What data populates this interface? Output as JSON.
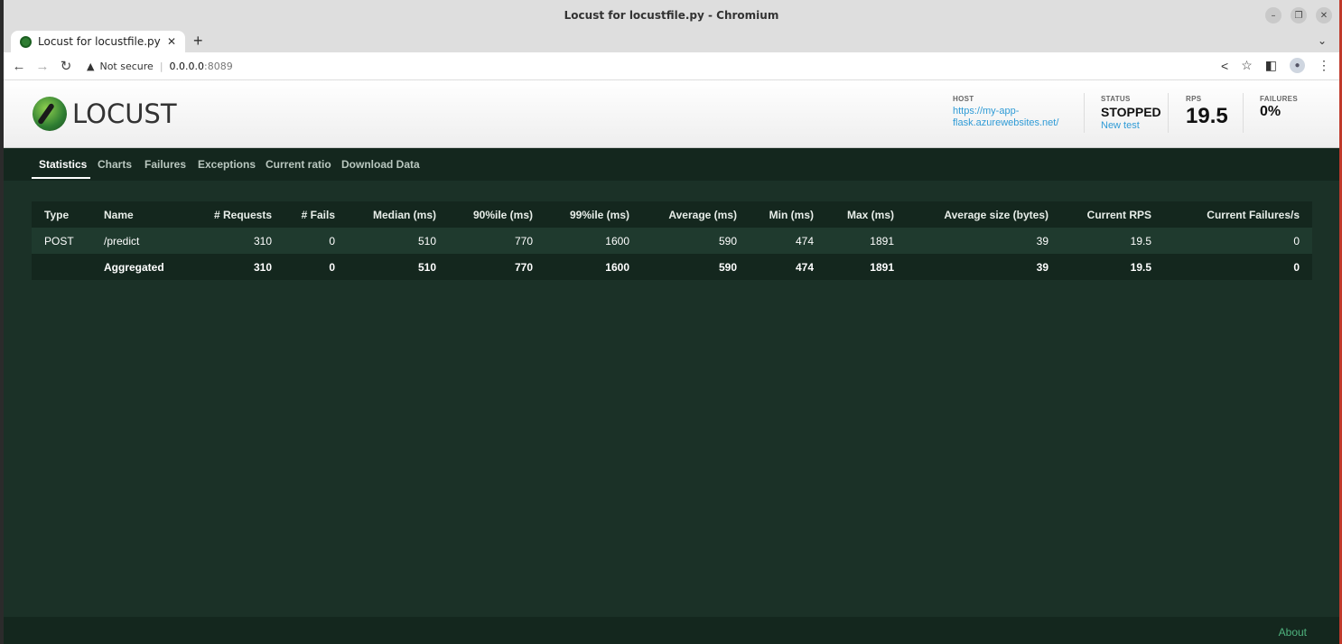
{
  "window": {
    "title": "Locust for locustfile.py - Chromium"
  },
  "browser": {
    "tab_title": "Locust for locustfile.py",
    "new_tab": "+",
    "security_label": "Not secure",
    "url_host": "0.0.0.0",
    "url_port": ":8089"
  },
  "header": {
    "logo_text": "LOCUST",
    "host_label": "HOST",
    "host_line1": "https://my-app-",
    "host_line2": "flask.azurewebsites.net/",
    "status_label": "STATUS",
    "status_value": "STOPPED",
    "new_test": "New test",
    "rps_label": "RPS",
    "rps_value": "19.5",
    "failures_label": "FAILURES",
    "failures_value": "0%"
  },
  "nav": {
    "tabs": [
      "Statistics",
      "Charts",
      "Failures",
      "Exceptions",
      "Current ratio",
      "Download Data"
    ]
  },
  "table": {
    "headers": [
      "Type",
      "Name",
      "# Requests",
      "# Fails",
      "Median (ms)",
      "90%ile (ms)",
      "99%ile (ms)",
      "Average (ms)",
      "Min (ms)",
      "Max (ms)",
      "Average size (bytes)",
      "Current RPS",
      "Current Failures/s"
    ],
    "rows": [
      [
        "POST",
        "/predict",
        "310",
        "0",
        "510",
        "770",
        "1600",
        "590",
        "474",
        "1891",
        "39",
        "19.5",
        "0"
      ]
    ],
    "aggregated": [
      "",
      "Aggregated",
      "310",
      "0",
      "510",
      "770",
      "1600",
      "590",
      "474",
      "1891",
      "39",
      "19.5",
      "0"
    ]
  },
  "footer": {
    "about": "About"
  }
}
